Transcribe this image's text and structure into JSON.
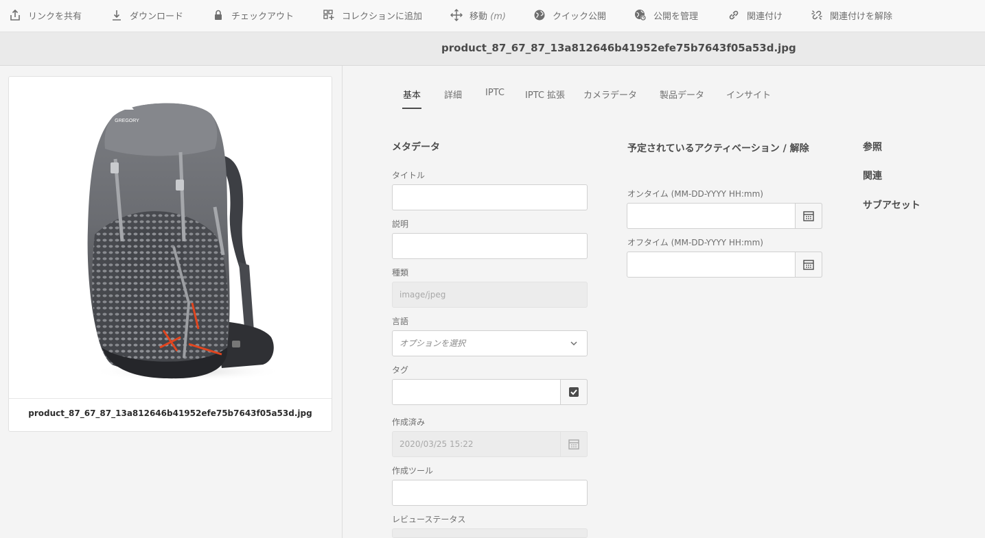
{
  "toolbar": {
    "share_link": "リンクを共有",
    "download": "ダウンロード",
    "checkout": "チェックアウト",
    "add_to_collection": "コレクションに追加",
    "move": "移動",
    "move_shortcut": "(m)",
    "quick_publish": "クイック公開",
    "manage_publication": "公開を管理",
    "relate": "関連付け",
    "unrelate": "関連付けを解除"
  },
  "header": {
    "file_title": "product_87_67_87_13a812646b41952efe75b7643f05a53d.jpg"
  },
  "preview": {
    "caption": "product_87_67_87_13a812646b41952efe75b7643f05a53d.jpg",
    "logo_text": "GREGORY"
  },
  "tabs": [
    "基本",
    "詳細",
    "IPTC",
    "IPTC 拡張",
    "カメラデータ",
    "製品データ",
    "インサイト"
  ],
  "metadata": {
    "section_title": "メタデータ",
    "title_label": "タイトル",
    "title_value": "",
    "description_label": "説明",
    "description_value": "",
    "type_label": "種類",
    "type_value": "image/jpeg",
    "language_label": "言語",
    "language_placeholder": "オプションを選択",
    "tags_label": "タグ",
    "tags_value": "",
    "created_label": "作成済み",
    "created_value": "2020/03/25 15:22",
    "creator_tool_label": "作成ツール",
    "creator_tool_value": "",
    "review_status_label": "レビューステータス"
  },
  "schedule": {
    "section_title": "予定されているアクティベーション / 解除",
    "on_time_label": "オンタイム (MM-DD-YYYY HH:mm)",
    "on_time_value": "",
    "off_time_label": "オフタイム (MM-DD-YYYY HH:mm)",
    "off_time_value": ""
  },
  "side_links": {
    "references": "参照",
    "related": "関連",
    "subassets": "サブアセット"
  },
  "icons": [
    "share-icon",
    "download-icon",
    "lock-icon",
    "add-to-collection-icon",
    "move-icon",
    "globe-icon",
    "globe-gear-icon",
    "link-icon",
    "unlink-icon",
    "calendar-icon",
    "checkmark-icon",
    "chevron-down-icon"
  ]
}
